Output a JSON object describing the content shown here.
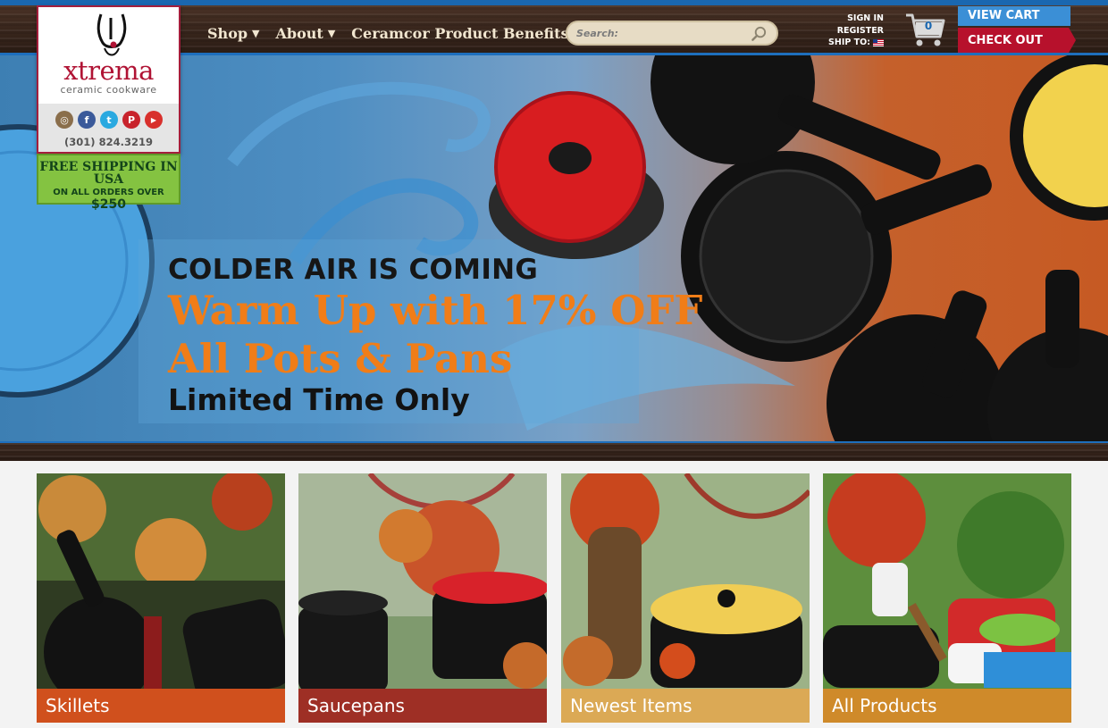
{
  "header": {
    "nav": [
      {
        "label": "Shop"
      },
      {
        "label": "About"
      },
      {
        "label": "Ceramcor Product Benefits"
      }
    ],
    "search": {
      "placeholder": "Search:"
    },
    "account": {
      "sign_in": "SIGN IN",
      "register": "REGISTER",
      "ship_to": "SHIP TO:"
    },
    "cart": {
      "count": "0",
      "view_cart": "VIEW CART",
      "checkout": "CHECK OUT"
    }
  },
  "brand": {
    "name": "xtrema",
    "tagline": "ceramic cookware",
    "phone": "(301) 824.3219",
    "socials": [
      {
        "icon": "instagram-icon",
        "glyph": "◎",
        "color": "#8a6e4b"
      },
      {
        "icon": "facebook-icon",
        "glyph": "f",
        "color": "#3b5a9a"
      },
      {
        "icon": "twitter-icon",
        "glyph": "t",
        "color": "#2aa9e0"
      },
      {
        "icon": "pinterest-icon",
        "glyph": "P",
        "color": "#c8232c"
      },
      {
        "icon": "youtube-icon",
        "glyph": "▶",
        "color": "#d8302c"
      }
    ],
    "shipping": {
      "line1": "FREE SHIPPING IN USA",
      "line2": "ON ALL ORDERS OVER",
      "amount": "$250"
    }
  },
  "hero": {
    "line1": "COLDER AIR IS COMING",
    "line2": "Warm Up with 17% OFF",
    "line3": "All Pots & Pans",
    "line4": "Limited Time Only"
  },
  "categories": [
    {
      "label": "Skillets",
      "color": "#d0501d"
    },
    {
      "label": "Saucepans",
      "color": "#9e2f25"
    },
    {
      "label": "Newest Items",
      "color": "#dba955"
    },
    {
      "label": "All Products",
      "color": "#cf8a2a"
    }
  ],
  "colors": {
    "accent_blue": "#1a67b0",
    "brand_red": "#b01334",
    "promo_orange": "#f07d18",
    "shipping_green": "#84c341"
  }
}
